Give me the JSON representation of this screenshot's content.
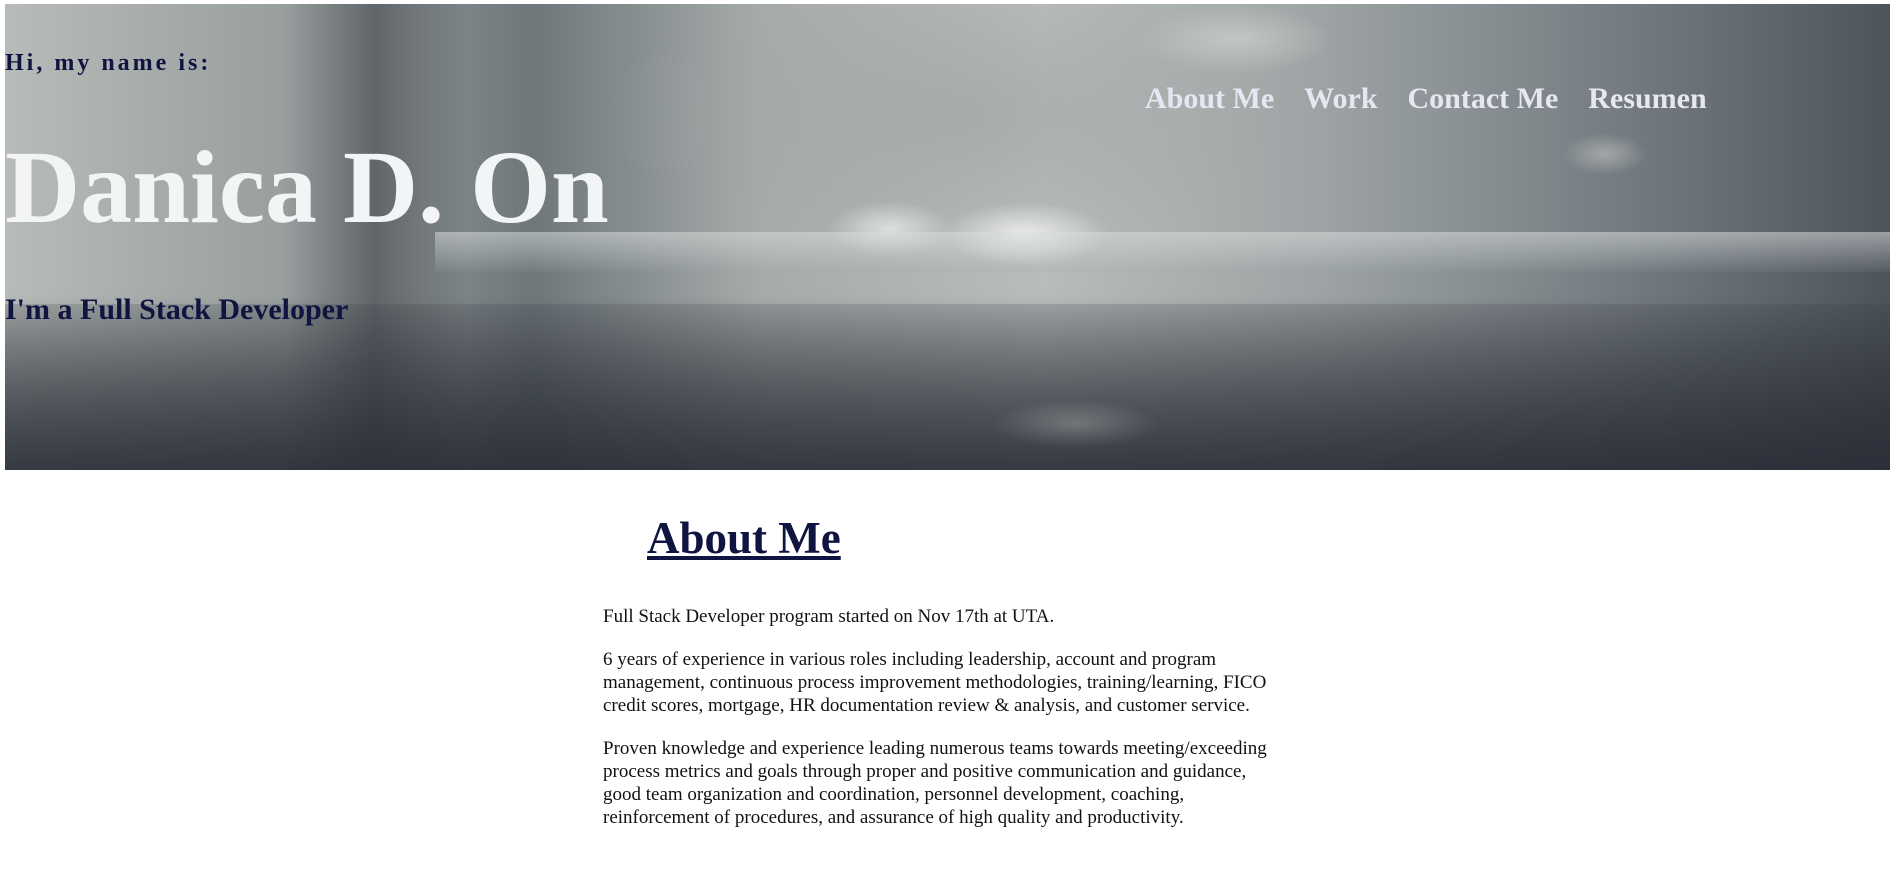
{
  "hero": {
    "greeting": "Hi, my name is:",
    "name": "Danica D. On",
    "tagline": "I'm a Full Stack Developer",
    "background": "blurred-office-photo"
  },
  "nav": {
    "items": [
      {
        "label": "About Me"
      },
      {
        "label": "Work"
      },
      {
        "label": "Contact Me"
      },
      {
        "label": "Resumen"
      }
    ]
  },
  "about": {
    "title": "About Me",
    "paragraphs": [
      "Full Stack Developer program started on Nov 17th at UTA.",
      "6 years of experience in various roles including leadership, account and program management, continuous process improvement methodologies, training/learning, FICO credit scores, mortgage, HR documentation review & analysis, and customer service.",
      "Proven knowledge and experience leading numerous teams towards meeting/exceeding process metrics and goals through proper and positive communication and guidance, good team organization and coordination, personnel development, coaching, reinforcement of procedures, and assurance of high quality and productivity."
    ]
  },
  "colors": {
    "heading_navy": "#0f1440",
    "name_white": "#f3f4f6",
    "nav_text": "#e6e7f2",
    "body_text": "#111111"
  }
}
